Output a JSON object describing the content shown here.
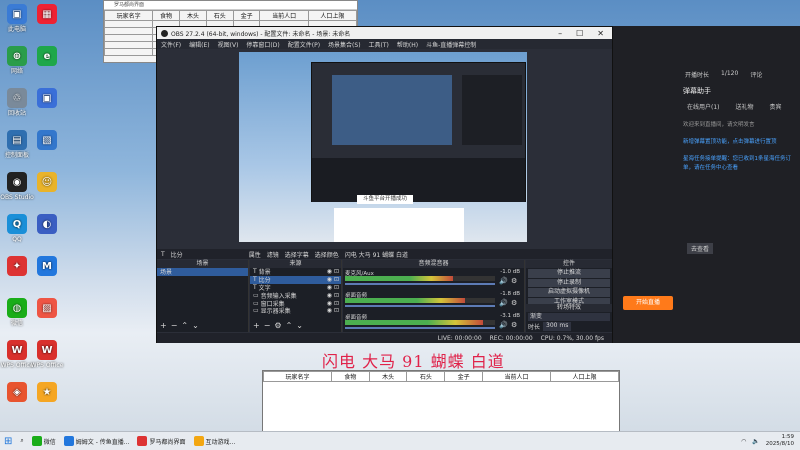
{
  "desktop_icons": [
    {
      "label": "此电脑",
      "color": "#3a7bd5",
      "glyph": "▣"
    },
    {
      "label": "网络",
      "color": "#2a9d4a",
      "glyph": "⊕"
    },
    {
      "label": "回收站",
      "color": "#7a8a9a",
      "glyph": "♲"
    },
    {
      "label": "控制面板",
      "color": "#2f6fb0",
      "glyph": "▤"
    },
    {
      "label": "OBS Studio",
      "color": "#222",
      "glyph": "◉"
    },
    {
      "label": "QQ",
      "color": "#1a8fd8",
      "glyph": "Q"
    },
    {
      "label": "",
      "color": "#d33",
      "glyph": "✦"
    },
    {
      "label": "微信",
      "color": "#1aad19",
      "glyph": "◍"
    },
    {
      "label": "WPS Office",
      "color": "#d9302c",
      "glyph": "W"
    },
    {
      "label": "",
      "color": "#e8542f",
      "glyph": "◈"
    }
  ],
  "desktop_icons_col2": [
    {
      "label": "",
      "color": "#e23",
      "glyph": "▦"
    },
    {
      "label": "",
      "color": "#1fa74a",
      "glyph": "e"
    },
    {
      "label": "",
      "color": "#3a6fd8",
      "glyph": "▣"
    },
    {
      "label": "",
      "color": "#3377cc",
      "glyph": "▧"
    },
    {
      "label": "",
      "color": "#e9b32a",
      "glyph": "☺"
    },
    {
      "label": "",
      "color": "#3a5ec2",
      "glyph": "◐"
    },
    {
      "label": "",
      "color": "#2277dd",
      "glyph": "M"
    },
    {
      "label": "",
      "color": "#e54",
      "glyph": "▨"
    },
    {
      "label": "WPS Office",
      "color": "#d9302c",
      "glyph": "W"
    },
    {
      "label": "",
      "color": "#f5a623",
      "glyph": "★"
    }
  ],
  "game_window": {
    "title": "罗马都尚界面",
    "columns": [
      "玩家名字",
      "食物",
      "木头",
      "石头",
      "金子",
      "当前人口",
      "人口上限"
    ]
  },
  "obs": {
    "title": "OBS 27.2.4 (64-bit, windows) - 配置文件: 未命名 - 场景: 未命名",
    "menu": [
      "文件(F)",
      "编辑(E)",
      "视图(V)",
      "停靠窗口(D)",
      "配置文件(P)",
      "场景集合(S)",
      "工具(T)",
      "帮助(H)",
      "斗鱼-直播弹幕控制"
    ],
    "notice": "斗鱼平台开播成功",
    "source_bar": {
      "selected": "比分",
      "props": "属性",
      "filters": "滤镜",
      "select_device": "选择字幕",
      "select_color": "选择颜色",
      "label": "闪电 大马 91 蝴蝶 白道"
    },
    "panels": {
      "scenes": "场景",
      "sources": "来源",
      "mixer": "音频混音器",
      "transitions": "转场特效",
      "controls": "控件"
    },
    "scene_items": [
      "场景"
    ],
    "source_items": [
      "背景",
      "比分",
      "文字",
      "音频输入采集",
      "窗口采集",
      "显示器采集"
    ],
    "mixer_tracks": [
      {
        "name": "麦克风/Aux",
        "db": "-1.0 dB",
        "level": 0.72
      },
      {
        "name": "桌面音频",
        "db": "-1.8 dB",
        "level": 0.8
      },
      {
        "name": "桌面音频",
        "db": "-3.1 dB",
        "level": 0.92
      }
    ],
    "controls": [
      "停止推流",
      "停止录制",
      "启动虚拟摄像机",
      "工作室模式",
      "设置",
      "退出"
    ],
    "transition": {
      "type": "渐变",
      "duration_label": "时长",
      "duration": "300 ms"
    },
    "status": {
      "live": "LIVE: 00:00:00",
      "rec": "REC: 00:00:00",
      "cpu": "CPU: 0.7%, 30.00 fps"
    }
  },
  "chat": {
    "tabs": [
      "开播时长",
      "1/120",
      "评论"
    ],
    "title": "弹幕助手",
    "subtabs": [
      "在线用户(1)",
      "送礼物",
      "贵宾"
    ],
    "messages": [
      "欢迎来到直播间，请文明发言",
      "新增弹幕置顶功能，点击弹幕进行置顶",
      "星海任务接单提醒：您已收到1条星海任务订单，请在任务中心查看"
    ],
    "go_button": "去查看",
    "start_button": "开始直播"
  },
  "overlay_text": "闪电 大马 91 蝴蝶 白道",
  "bottom_table": {
    "columns": [
      "玩家名字",
      "食物",
      "木头",
      "石头",
      "金子",
      "当前人口",
      "人口上限"
    ]
  },
  "taskbar": {
    "items": [
      {
        "label": "微信",
        "color": "#1aad19"
      },
      {
        "label": "姆姆文 - 传鱼直播...",
        "color": "#2277dd"
      },
      {
        "label": "罗马都尚界面",
        "color": "#d33"
      },
      {
        "label": "互动游戏...",
        "color": "#f3a712"
      }
    ],
    "time": "1:59",
    "date": "2025/8/10"
  }
}
